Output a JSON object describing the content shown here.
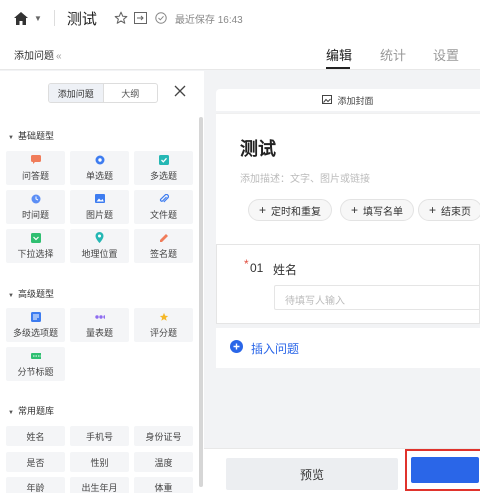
{
  "topbar": {
    "title": "测试",
    "save_status": "最近保存 16:43"
  },
  "tabbar": {
    "add_question": "添加问题",
    "tabs": [
      "编辑",
      "统计",
      "设置"
    ]
  },
  "left": {
    "segments": [
      "添加问题",
      "大纲"
    ],
    "sections": {
      "basic": {
        "title": "基础题型",
        "items": [
          "问答题",
          "单选题",
          "多选题",
          "时间题",
          "图片题",
          "文件题",
          "下拉选择",
          "地理位置",
          "签名题"
        ]
      },
      "advanced": {
        "title": "高级题型",
        "items": [
          "多级选项题",
          "量表题",
          "评分题",
          "分节标题"
        ]
      },
      "common": {
        "title": "常用题库",
        "items": [
          "姓名",
          "手机号",
          "身份证号",
          "是否",
          "性别",
          "温度",
          "年龄",
          "出生年月",
          "体重"
        ]
      }
    }
  },
  "editor": {
    "add_cover": "添加封面",
    "survey_title": "测试",
    "description_placeholder": "添加描述：文字、图片或链接",
    "buttons": [
      "定时和重复",
      "填写名单",
      "结束页"
    ],
    "question": {
      "number": "01",
      "title": "姓名",
      "placeholder": "待填写人输入"
    },
    "insert_question": "插入问题"
  },
  "bottom": {
    "preview": "预览",
    "publish": ""
  },
  "colors": {
    "accent": "#2a66e8",
    "required": "#e04d3f",
    "highlight_border": "#e0332c"
  }
}
